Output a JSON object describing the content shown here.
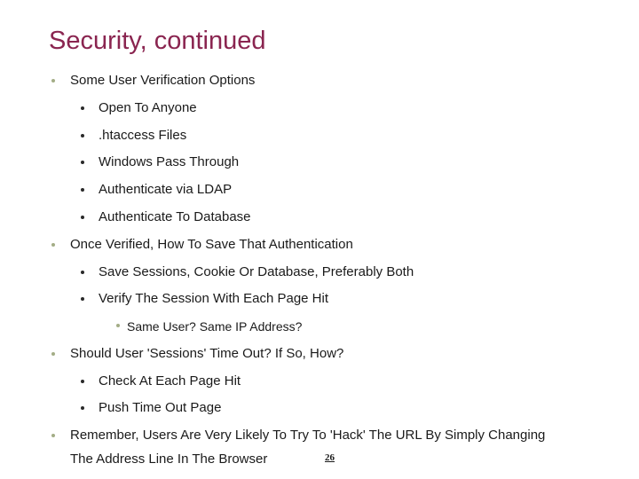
{
  "slide": {
    "title": "Security, continued",
    "title_color": "#8a2550",
    "page_number": "26",
    "bullets": [
      {
        "text": "Some User Verification Options",
        "children": [
          {
            "text": "Open To Anyone"
          },
          {
            "text": ".htaccess Files"
          },
          {
            "text": "Windows Pass Through"
          },
          {
            "text": "Authenticate via LDAP"
          },
          {
            "text": "Authenticate To Database"
          }
        ]
      },
      {
        "text": "Once Verified, How To Save That Authentication",
        "children": [
          {
            "text": "Save Sessions, Cookie Or Database, Preferably Both"
          },
          {
            "text": "Verify The Session With Each Page Hit",
            "children": [
              {
                "text": "Same User? Same IP Address?"
              }
            ]
          }
        ]
      },
      {
        "text": "Should User 'Sessions' Time Out? If So, How?",
        "children": [
          {
            "text": "Check At Each Page Hit"
          },
          {
            "text": "Push Time Out Page"
          }
        ]
      },
      {
        "text_line1": "Remember,  Users Are Very Likely To Try To 'Hack' The URL By Simply Changing",
        "text_line2": "The Address Line In The Browser"
      }
    ]
  }
}
